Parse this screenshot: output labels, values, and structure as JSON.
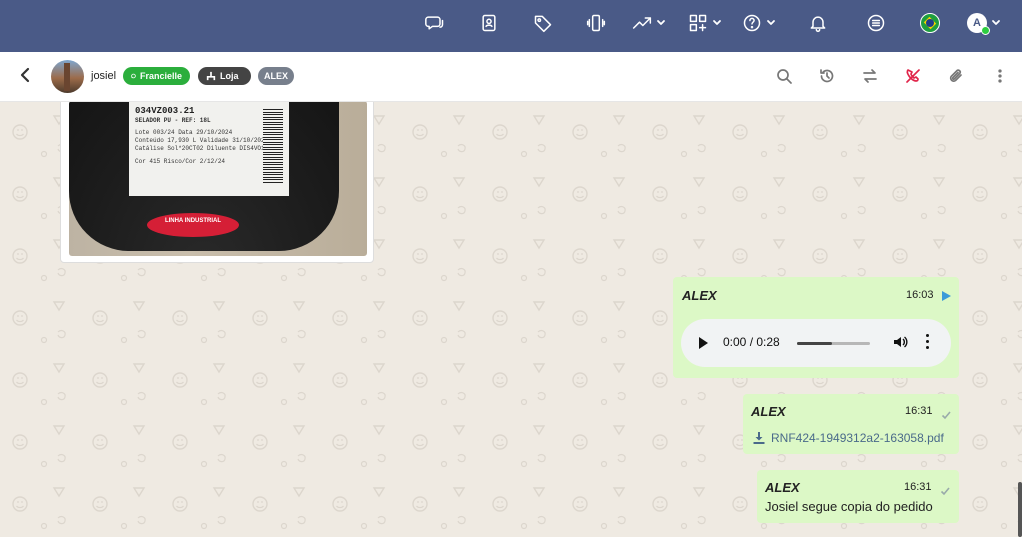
{
  "topbar": {
    "icons": [
      "chat-bubbles-icon",
      "contact-card-icon",
      "tag-icon",
      "phone-vibrate-icon",
      "trending-up-icon",
      "apps-grid-icon",
      "help-icon",
      "bell-icon",
      "menu-list-icon",
      "brazil-flag-icon",
      "user-avatar"
    ],
    "avatar_initial": "A",
    "colors": {
      "bar": "#4a5a87",
      "online": "#2ecc40"
    }
  },
  "chat_header": {
    "contact_name": "josiel",
    "tags": [
      {
        "label": "Francielle",
        "icon": "whatsapp-icon",
        "color": "#2bae3c"
      },
      {
        "label": "Loja",
        "icon": "org-chart-icon",
        "color": "#444444"
      },
      {
        "label": "ALEX",
        "color": "#777f8c"
      }
    ],
    "actions": [
      "search-icon",
      "history-icon",
      "transfer-icon",
      "end-call-icon",
      "attach-icon",
      "more-vertical-icon"
    ]
  },
  "messages": {
    "image": {
      "label_code": "034VZ003.21",
      "label_product": "SELADOR PU - REF: 18L",
      "label_lines": [
        "Lote      003/24    Data     29/10/2024",
        "Conteúdo 17,930  L  Validade  31/10/2026",
        "Catálise Sol*20CT02  Diluente  DIS4VO10",
        "Cor       415       Risco/Cor  2/12/24"
      ],
      "sticker": "LINHA INDUSTRIAL"
    },
    "audio": {
      "sender": "ALEX",
      "time": "16:03",
      "player_time": "0:00 / 0:28",
      "progress": 0.48
    },
    "file": {
      "sender": "ALEX",
      "time": "16:31",
      "filename": "RNF424-1949312a2-163058.pdf"
    },
    "text": {
      "sender": "ALEX",
      "time": "16:31",
      "body": "Josiel segue copia do pedido"
    }
  },
  "colors": {
    "chat_bg": "#efeae2",
    "outgoing_bubble": "#dcf8c6",
    "link": "#4a6a8a",
    "audio_status": "#3a9bd9"
  }
}
